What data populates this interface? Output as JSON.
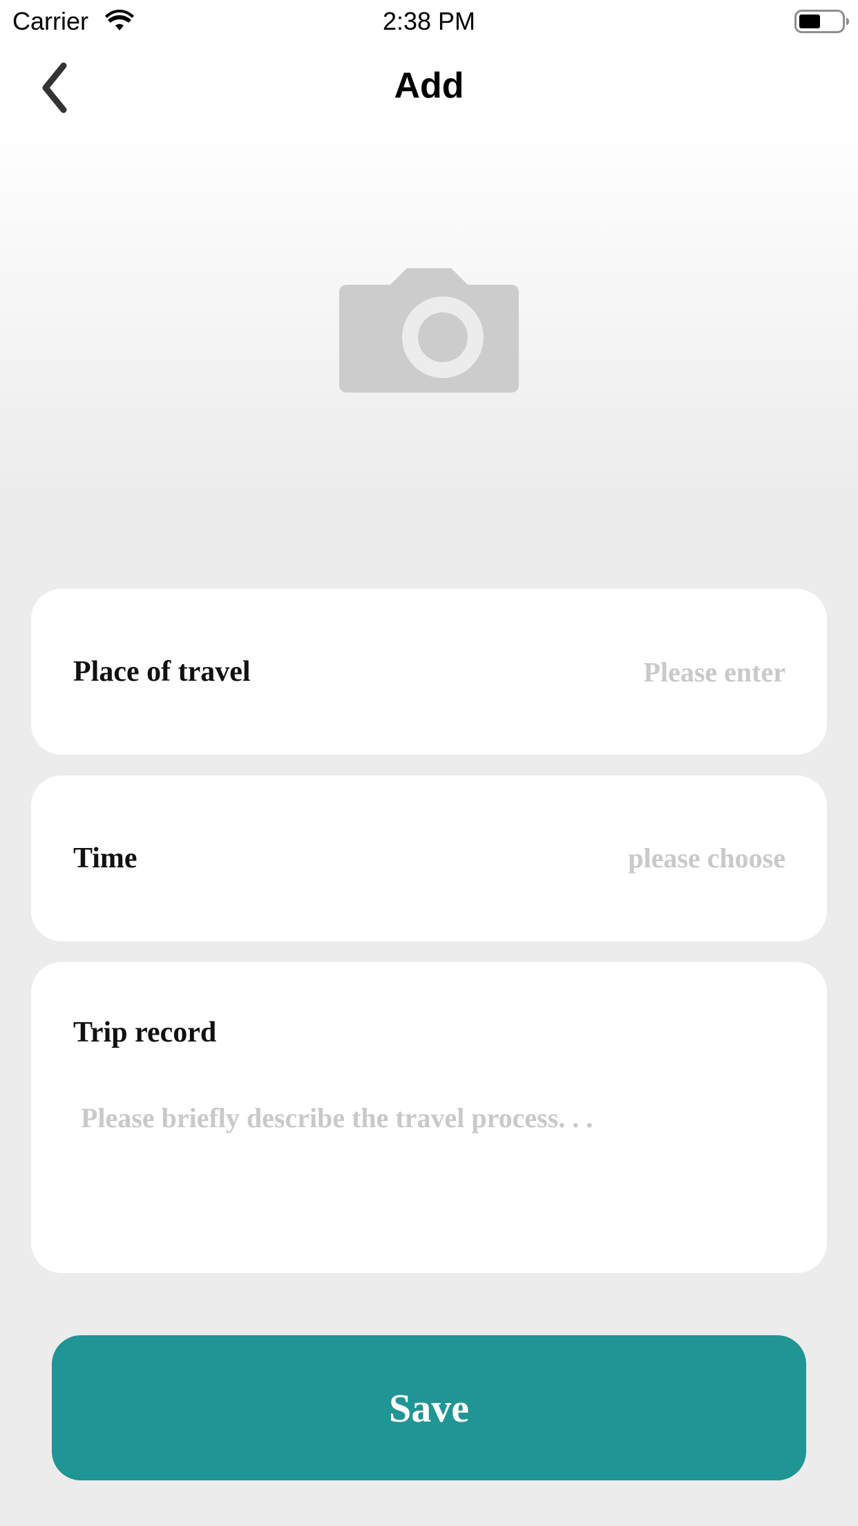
{
  "status_bar": {
    "carrier": "Carrier",
    "time": "2:38 PM",
    "wifi_icon": "wifi-icon",
    "battery_icon": "battery-icon"
  },
  "nav": {
    "back_icon": "chevron-left-icon",
    "title": "Add"
  },
  "photo": {
    "icon": "camera-icon"
  },
  "form": {
    "place": {
      "label": "Place of travel",
      "placeholder": "Please enter",
      "value": ""
    },
    "time": {
      "label": "Time",
      "placeholder": "please choose"
    },
    "trip": {
      "label": "Trip record",
      "placeholder": "Please briefly describe the travel process. . .",
      "value": ""
    }
  },
  "save_label": "Save",
  "colors": {
    "accent": "#1f9594",
    "placeholder": "#c9c9c9",
    "background": "#ececec",
    "card": "#ffffff",
    "camera_icon": "#cccccc"
  }
}
